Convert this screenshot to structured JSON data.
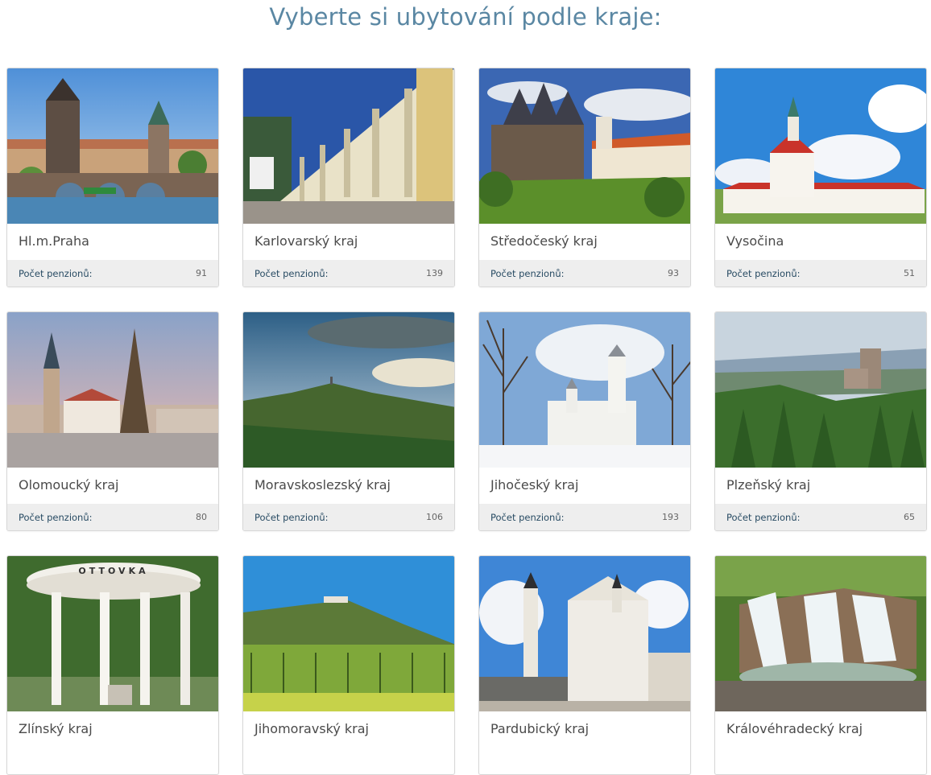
{
  "heading": "Vyberte si ubytování podle kraje:",
  "count_label": "Počet penzionů:",
  "regions": [
    {
      "name": "Hl.m.Praha",
      "count": "91"
    },
    {
      "name": "Karlovarský kraj",
      "count": "139"
    },
    {
      "name": "Středočeský kraj",
      "count": "93"
    },
    {
      "name": "Vysočina",
      "count": "51"
    },
    {
      "name": "Olomoucký kraj",
      "count": "80"
    },
    {
      "name": "Moravskoslezský kraj",
      "count": "106"
    },
    {
      "name": "Jihočeský kraj",
      "count": "193"
    },
    {
      "name": "Plzeňský kraj",
      "count": "65"
    },
    {
      "name": "Zlínský kraj"
    },
    {
      "name": "Jihomoravský kraj"
    },
    {
      "name": "Pardubický kraj"
    },
    {
      "name": "Královéhradecký kraj"
    }
  ],
  "image_text": {
    "colonnade_sign": "OTTOVKA"
  }
}
